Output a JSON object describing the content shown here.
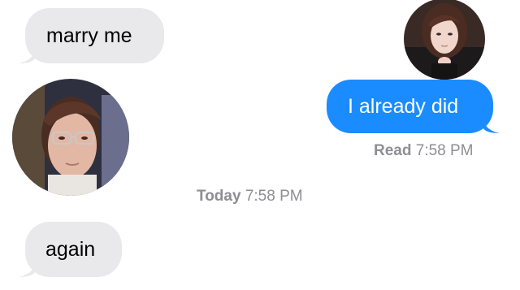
{
  "messages": {
    "incoming_1": "marry me",
    "outgoing_1": "I already did",
    "incoming_2": "again"
  },
  "receipt": {
    "label": "Read",
    "time": "7:58 PM"
  },
  "separator": {
    "label": "Today",
    "time": "7:58 PM"
  },
  "colors": {
    "incoming_bubble": "#e9e9eb",
    "outgoing_bubble": "#1a8cff",
    "meta_text": "#8e8e93"
  }
}
